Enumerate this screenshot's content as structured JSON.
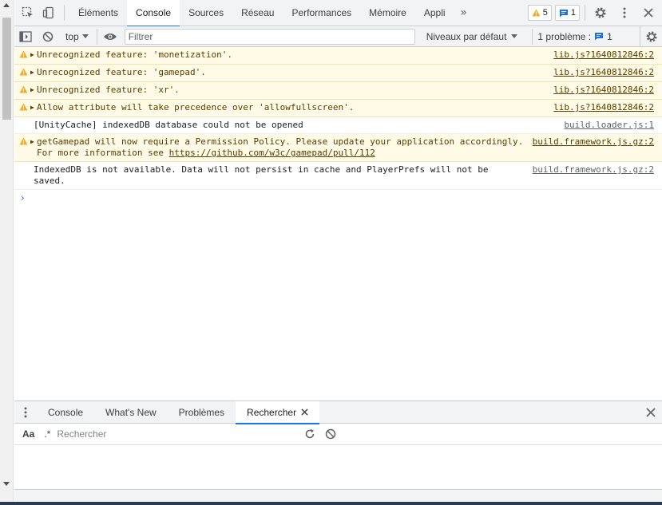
{
  "tabs": [
    {
      "label": "Éléments"
    },
    {
      "label": "Console"
    },
    {
      "label": "Sources"
    },
    {
      "label": "Réseau"
    },
    {
      "label": "Performances"
    },
    {
      "label": "Mémoire"
    },
    {
      "label": "Appli"
    }
  ],
  "badges": {
    "warnings_count": "5",
    "issues_count": "1"
  },
  "console_toolbar": {
    "context": "top",
    "filter_placeholder": "Filtrer",
    "levels": "Niveaux par défaut",
    "problems_label": "1 problème :",
    "problems_count": "1"
  },
  "messages": [
    {
      "level": "warning",
      "expandable": true,
      "text": "Unrecognized feature: 'monetization'.",
      "source": "lib.js?1640812846:2"
    },
    {
      "level": "warning",
      "expandable": true,
      "text": "Unrecognized feature: 'gamepad'.",
      "source": "lib.js?1640812846:2"
    },
    {
      "level": "warning",
      "expandable": true,
      "text": "Unrecognized feature: 'xr'.",
      "source": "lib.js?1640812846:2"
    },
    {
      "level": "warning",
      "expandable": true,
      "text": "Allow attribute will take precedence over 'allowfullscreen'.",
      "source": "lib.js?1640812846:2"
    },
    {
      "level": "info",
      "expandable": false,
      "text": "[UnityCache] indexedDB database could not be opened",
      "source": "build.loader.js:1"
    },
    {
      "level": "warning",
      "expandable": true,
      "text": "getGamepad will now require a Permission Policy. Please update your application accordingly. For more information see ",
      "link": "https://github.com/w3c/gamepad/pull/112",
      "source": "build.framework.js.gz:2"
    },
    {
      "level": "info",
      "expandable": false,
      "text": "IndexedDB is not available. Data will not persist in cache and PlayerPrefs will not be saved.",
      "source": "build.framework.js.gz:2"
    }
  ],
  "prompt_symbol": "›",
  "drawer": {
    "tabs": [
      {
        "label": "Console"
      },
      {
        "label": "What's New"
      },
      {
        "label": "Problèmes"
      }
    ],
    "active_tab": "Rechercher",
    "case_label": "Aa",
    "regex_label": ".*",
    "search_placeholder": "Rechercher"
  },
  "colors": {
    "accent": "#1a73e8",
    "warning_bg": "#fffbe6",
    "warning_icon": "#f2ab26"
  }
}
